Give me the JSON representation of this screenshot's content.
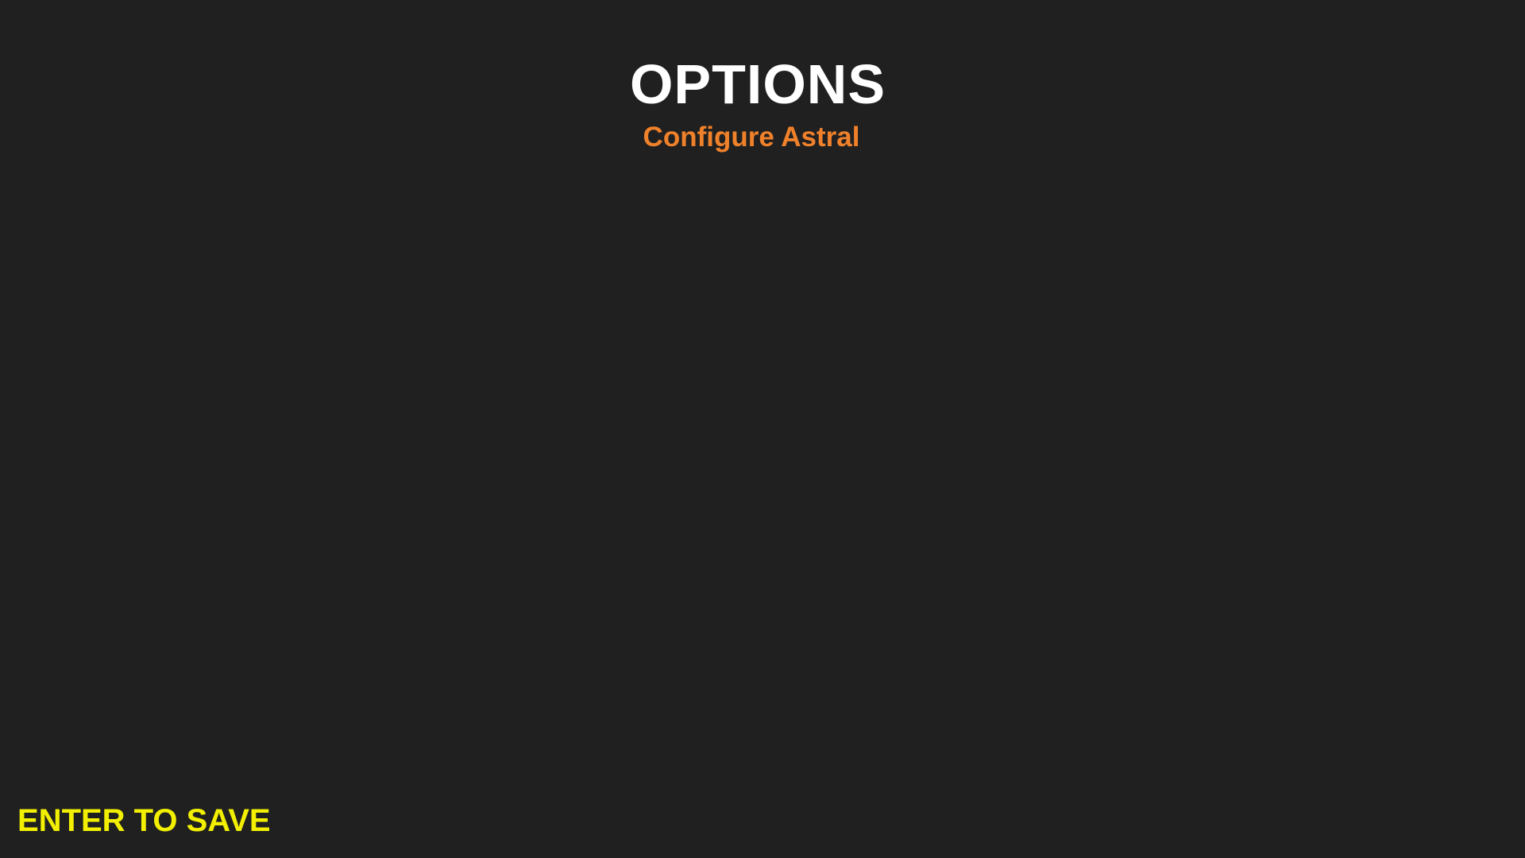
{
  "screen": {
    "title": "OPTIONS",
    "subtitle": "Configure Astral",
    "save_hint": "ENTER TO SAVE",
    "colors": {
      "background": "#202020",
      "title": "#ffffff",
      "subtitle": "#f0812b",
      "save_hint": "#f2ef00"
    }
  }
}
